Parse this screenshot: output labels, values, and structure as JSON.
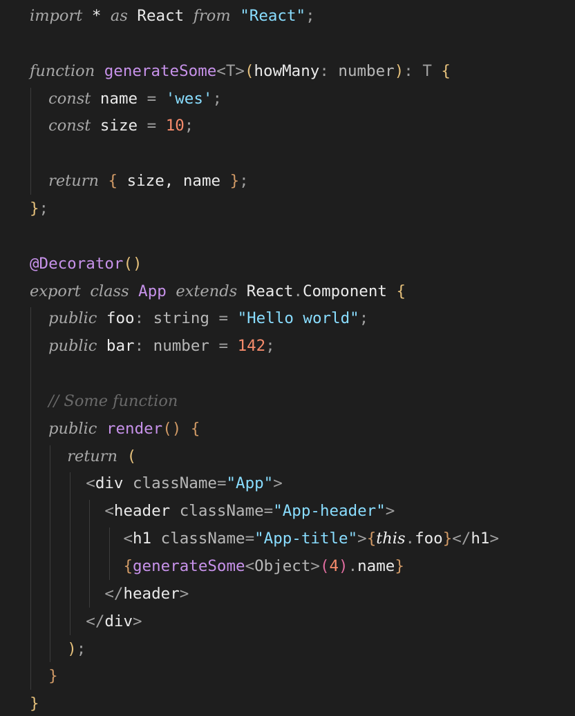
{
  "editor": {
    "lines": [
      [
        {
          "t": "import",
          "c": "kw"
        },
        {
          "t": " * ",
          "c": "plain"
        },
        {
          "t": "as",
          "c": "kw"
        },
        {
          "t": " React ",
          "c": "plain"
        },
        {
          "t": "from",
          "c": "kw"
        },
        {
          "t": " ",
          "c": "plain"
        },
        {
          "t": "\"React\"",
          "c": "str"
        },
        {
          "t": ";",
          "c": "punc"
        }
      ],
      [],
      [
        {
          "t": "function",
          "c": "kw"
        },
        {
          "t": " ",
          "c": "plain"
        },
        {
          "t": "generateSome",
          "c": "fn"
        },
        {
          "t": "<T>",
          "c": "punc"
        },
        {
          "t": "(",
          "c": "brY"
        },
        {
          "t": "howMany",
          "c": "plain"
        },
        {
          "t": ": ",
          "c": "punc"
        },
        {
          "t": "number",
          "c": "type"
        },
        {
          "t": ")",
          "c": "brY"
        },
        {
          "t": ": T ",
          "c": "punc"
        },
        {
          "t": "{",
          "c": "brY"
        }
      ],
      [
        {
          "t": "  ",
          "c": "plain"
        },
        {
          "t": "const",
          "c": "kw"
        },
        {
          "t": " name ",
          "c": "plain"
        },
        {
          "t": "= ",
          "c": "punc"
        },
        {
          "t": "'wes'",
          "c": "str"
        },
        {
          "t": ";",
          "c": "punc"
        }
      ],
      [
        {
          "t": "  ",
          "c": "plain"
        },
        {
          "t": "const",
          "c": "kw"
        },
        {
          "t": " size ",
          "c": "plain"
        },
        {
          "t": "= ",
          "c": "punc"
        },
        {
          "t": "10",
          "c": "num"
        },
        {
          "t": ";",
          "c": "punc"
        }
      ],
      [],
      [
        {
          "t": "  ",
          "c": "plain"
        },
        {
          "t": "return",
          "c": "kw"
        },
        {
          "t": " ",
          "c": "plain"
        },
        {
          "t": "{",
          "c": "brO"
        },
        {
          "t": " size, name ",
          "c": "plain"
        },
        {
          "t": "}",
          "c": "brO"
        },
        {
          "t": ";",
          "c": "punc"
        }
      ],
      [
        {
          "t": "}",
          "c": "brY"
        },
        {
          "t": ";",
          "c": "punc"
        }
      ],
      [],
      [
        {
          "t": "@Decorator",
          "c": "fn"
        },
        {
          "t": "()",
          "c": "brY"
        }
      ],
      [
        {
          "t": "export",
          "c": "kw"
        },
        {
          "t": " ",
          "c": "plain"
        },
        {
          "t": "class",
          "c": "kw"
        },
        {
          "t": " ",
          "c": "plain"
        },
        {
          "t": "App",
          "c": "fn"
        },
        {
          "t": " ",
          "c": "plain"
        },
        {
          "t": "extends",
          "c": "kw"
        },
        {
          "t": " React",
          "c": "plain"
        },
        {
          "t": ".",
          "c": "punc"
        },
        {
          "t": "Component ",
          "c": "plain"
        },
        {
          "t": "{",
          "c": "brY"
        }
      ],
      [
        {
          "t": "  ",
          "c": "plain"
        },
        {
          "t": "public",
          "c": "kw"
        },
        {
          "t": " foo",
          "c": "plain"
        },
        {
          "t": ": ",
          "c": "punc"
        },
        {
          "t": "string ",
          "c": "type"
        },
        {
          "t": "= ",
          "c": "punc"
        },
        {
          "t": "\"Hello world\"",
          "c": "str"
        },
        {
          "t": ";",
          "c": "punc"
        }
      ],
      [
        {
          "t": "  ",
          "c": "plain"
        },
        {
          "t": "public",
          "c": "kw"
        },
        {
          "t": " bar",
          "c": "plain"
        },
        {
          "t": ": ",
          "c": "punc"
        },
        {
          "t": "number ",
          "c": "type"
        },
        {
          "t": "= ",
          "c": "punc"
        },
        {
          "t": "142",
          "c": "num"
        },
        {
          "t": ";",
          "c": "punc"
        }
      ],
      [],
      [
        {
          "t": "  ",
          "c": "plain"
        },
        {
          "t": "// Some function",
          "c": "com"
        }
      ],
      [
        {
          "t": "  ",
          "c": "plain"
        },
        {
          "t": "public",
          "c": "kw"
        },
        {
          "t": " ",
          "c": "plain"
        },
        {
          "t": "render",
          "c": "fn"
        },
        {
          "t": "()",
          "c": "brO"
        },
        {
          "t": " ",
          "c": "plain"
        },
        {
          "t": "{",
          "c": "brO"
        }
      ],
      [
        {
          "t": "    ",
          "c": "plain"
        },
        {
          "t": "return",
          "c": "kw"
        },
        {
          "t": " ",
          "c": "plain"
        },
        {
          "t": "(",
          "c": "brY"
        }
      ],
      [
        {
          "t": "      ",
          "c": "plain"
        },
        {
          "t": "<",
          "c": "punc"
        },
        {
          "t": "div",
          "c": "plain"
        },
        {
          "t": " className",
          "c": "type"
        },
        {
          "t": "=",
          "c": "punc"
        },
        {
          "t": "\"App\"",
          "c": "str"
        },
        {
          "t": ">",
          "c": "punc"
        }
      ],
      [
        {
          "t": "        ",
          "c": "plain"
        },
        {
          "t": "<",
          "c": "punc"
        },
        {
          "t": "header",
          "c": "plain"
        },
        {
          "t": " className",
          "c": "type"
        },
        {
          "t": "=",
          "c": "punc"
        },
        {
          "t": "\"App-header\"",
          "c": "str"
        },
        {
          "t": ">",
          "c": "punc"
        }
      ],
      [
        {
          "t": "          ",
          "c": "plain"
        },
        {
          "t": "<",
          "c": "punc"
        },
        {
          "t": "h1",
          "c": "plain"
        },
        {
          "t": " className",
          "c": "type"
        },
        {
          "t": "=",
          "c": "punc"
        },
        {
          "t": "\"App-title\"",
          "c": "str"
        },
        {
          "t": ">",
          "c": "punc"
        },
        {
          "t": "{",
          "c": "brO"
        },
        {
          "t": "this",
          "c": "italic-white"
        },
        {
          "t": ".",
          "c": "punc"
        },
        {
          "t": "foo",
          "c": "plain"
        },
        {
          "t": "}",
          "c": "brO"
        },
        {
          "t": "</",
          "c": "punc"
        },
        {
          "t": "h1",
          "c": "plain"
        },
        {
          "t": ">",
          "c": "punc"
        }
      ],
      [
        {
          "t": "          ",
          "c": "plain"
        },
        {
          "t": "{",
          "c": "brO"
        },
        {
          "t": "generateSome",
          "c": "fn"
        },
        {
          "t": "<",
          "c": "punc"
        },
        {
          "t": "Object",
          "c": "type"
        },
        {
          "t": ">",
          "c": "punc"
        },
        {
          "t": "(",
          "c": "brM"
        },
        {
          "t": "4",
          "c": "num"
        },
        {
          "t": ")",
          "c": "brM"
        },
        {
          "t": ".",
          "c": "punc"
        },
        {
          "t": "name",
          "c": "plain"
        },
        {
          "t": "}",
          "c": "brO"
        }
      ],
      [
        {
          "t": "        ",
          "c": "plain"
        },
        {
          "t": "</",
          "c": "punc"
        },
        {
          "t": "header",
          "c": "plain"
        },
        {
          "t": ">",
          "c": "punc"
        }
      ],
      [
        {
          "t": "      ",
          "c": "plain"
        },
        {
          "t": "</",
          "c": "punc"
        },
        {
          "t": "div",
          "c": "plain"
        },
        {
          "t": ">",
          "c": "punc"
        }
      ],
      [
        {
          "t": "    ",
          "c": "plain"
        },
        {
          "t": ")",
          "c": "brY"
        },
        {
          "t": ";",
          "c": "punc"
        }
      ],
      [
        {
          "t": "  ",
          "c": "plain"
        },
        {
          "t": "}",
          "c": "brO"
        }
      ],
      [
        {
          "t": "}",
          "c": "brY"
        }
      ]
    ]
  },
  "colors": {
    "background": "#1e1e1e",
    "keyword": "#a8a8a8",
    "function": "#c792ea",
    "string": "#89ddff",
    "number": "#f78c6c",
    "bracket_yellow": "#e5c07b",
    "bracket_orange": "#d19a66",
    "bracket_magenta": "#e06c9f",
    "comment": "#6a6a6a",
    "indent_guide": "#3c3c3c"
  }
}
